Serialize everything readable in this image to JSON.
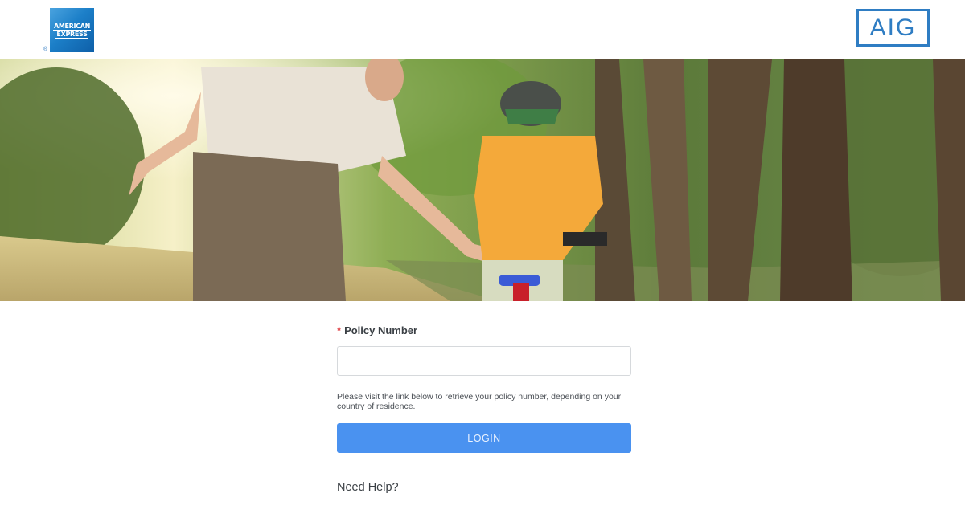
{
  "header": {
    "amex_logo": {
      "line1": "AMERICAN",
      "line2": "EXPRESS",
      "reg_mark": "®",
      "color": "#1c7fc8"
    },
    "aig_logo": {
      "text": "AIG",
      "color": "#2f7dc3"
    }
  },
  "hero": {
    "icon": "hero-photo"
  },
  "form": {
    "required_mark": "*",
    "policy_label": "Policy Number",
    "policy_value": "",
    "policy_placeholder": "",
    "help_note": "Please visit the link below to retrieve your policy number, depending on your country of residence.",
    "login_label": "LOGIN",
    "need_help_label": "Need Help?"
  },
  "colors": {
    "accent": "#4a92f0",
    "required": "#e0464a"
  }
}
